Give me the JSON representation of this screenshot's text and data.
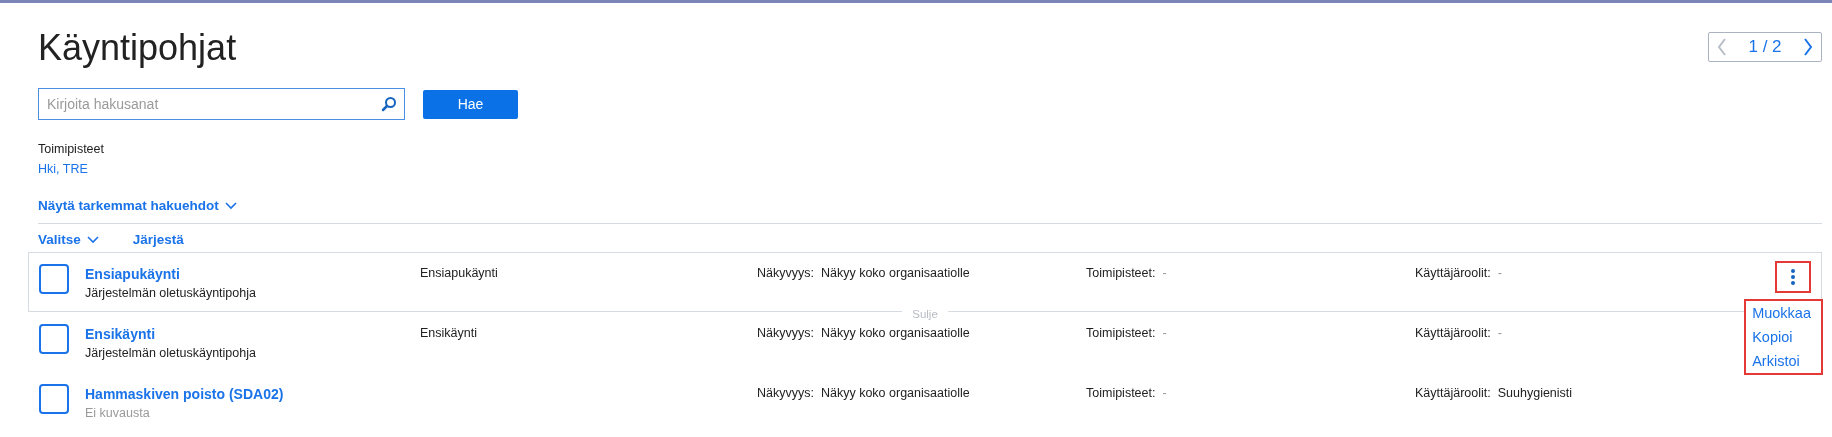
{
  "page": {
    "title": "Käyntipohjat"
  },
  "pager": {
    "label": "1 / 2",
    "prev_disabled": true,
    "next_disabled": false
  },
  "search": {
    "placeholder": "Kirjoita hakusanat",
    "button": "Hae"
  },
  "filter": {
    "label": "Toimipisteet",
    "value": "Hki, TRE"
  },
  "more_filters": {
    "label": "Näytä tarkemmat hakuehdot",
    "expanded": false
  },
  "toolbar": {
    "select": "Valitse",
    "sort": "Järjestä"
  },
  "rows": [
    {
      "name": "Ensiapukäynti",
      "description": "Järjestelmän oletuskäyntipohja",
      "has_description": true,
      "type": "Ensiapukäynti",
      "checked": false,
      "expanded": true,
      "collapse_label": "Sulje",
      "fields": [
        {
          "label": "Näkyvyys:",
          "value": "Näkyy koko organisaatiolle",
          "muted": false
        },
        {
          "label": "Toimipisteet:",
          "value": "-",
          "muted": true
        },
        {
          "label": "Käyttäjäroolit:",
          "value": "-",
          "muted": true
        }
      ],
      "menu_open": true,
      "highlighted": true,
      "menu": [
        "Muokkaa",
        "Kopioi",
        "Arkistoi"
      ]
    },
    {
      "name": "Ensikäynti",
      "description": "Järjestelmän oletuskäyntipohja",
      "has_description": true,
      "type": "Ensikäynti",
      "checked": false,
      "expanded": false,
      "fields": [
        {
          "label": "Näkyvyys:",
          "value": "Näkyy koko organisaatiolle",
          "muted": false
        },
        {
          "label": "Toimipisteet:",
          "value": "-",
          "muted": true
        },
        {
          "label": "Käyttäjäroolit:",
          "value": "-",
          "muted": true
        }
      ]
    },
    {
      "name": "Hammaskiven poisto (SDA02)",
      "description": "Ei kuvausta",
      "has_description": false,
      "checked": false,
      "expanded": false,
      "fields": [
        {
          "label": "Näkyvyys:",
          "value": "Näkyy koko organisaatiolle",
          "muted": false
        },
        {
          "label": "Toimipisteet:",
          "value": "-",
          "muted": true
        },
        {
          "label": "Käyttäjäroolit:",
          "value": "Suuhygienisti",
          "muted": false
        }
      ]
    }
  ]
}
